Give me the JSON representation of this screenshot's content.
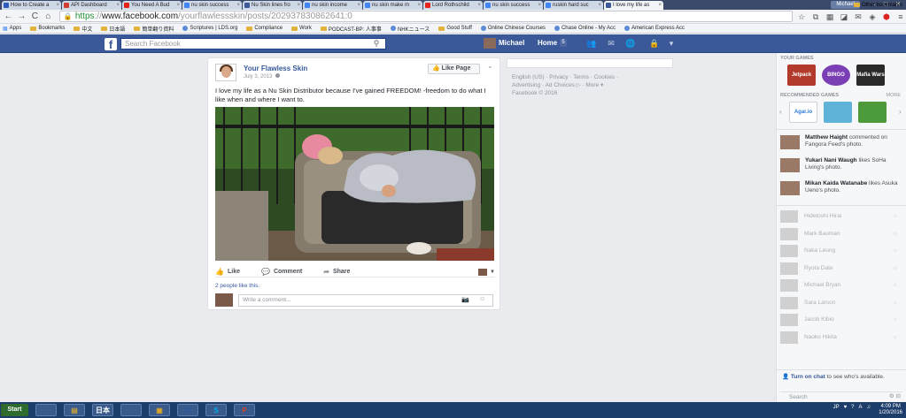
{
  "browser": {
    "tabs": [
      {
        "label": "How to Create a",
        "fav": "#2a5bbd"
      },
      {
        "label": "API Dashboard",
        "fav": "#d23f31"
      },
      {
        "label": "You Need A Bud",
        "fav": "#e62117"
      },
      {
        "label": "nu skin success",
        "fav": "#4285f4"
      },
      {
        "label": "Nu Skin lines fro",
        "fav": "#3b5998"
      },
      {
        "label": "nu skin income",
        "fav": "#4285f4"
      },
      {
        "label": "nu skin make m",
        "fav": "#4285f4"
      },
      {
        "label": "Lord Rothschild",
        "fav": "#e62117"
      },
      {
        "label": "nu skin success",
        "fav": "#4285f4"
      },
      {
        "label": "ruskin hard suc",
        "fav": "#4285f4"
      },
      {
        "label": "I love my life as",
        "fav": "#3b5998"
      }
    ],
    "window_user": "Michael",
    "window_controls": [
      "–",
      "□",
      "✕"
    ],
    "url_scheme": "https",
    "url_host": "www.facebook.com",
    "url_path": "/yourflawlessskin/posts/202937830862641:0",
    "nav": {
      "back": "←",
      "forward": "→",
      "reload": "C",
      "home": "⌂"
    }
  },
  "bookmarks": [
    {
      "label": "Apps",
      "kind": "apps"
    },
    {
      "label": "Bookmarks",
      "kind": "folder"
    },
    {
      "label": "中文",
      "kind": "folder"
    },
    {
      "label": "日本語",
      "kind": "folder"
    },
    {
      "label": "簡単翻り資料",
      "kind": "folder"
    },
    {
      "label": "Scriptures | LDS.org",
      "kind": "globe"
    },
    {
      "label": "Compliance",
      "kind": "folder"
    },
    {
      "label": "Work",
      "kind": "folder"
    },
    {
      "label": "PODCAST-BP: 人事事",
      "kind": "folder"
    },
    {
      "label": "NHKニュース",
      "kind": "globe"
    },
    {
      "label": "Good Stuff",
      "kind": "folder"
    },
    {
      "label": "Online Chinese Courses",
      "kind": "globe"
    },
    {
      "label": "Chase Online - My Acc",
      "kind": "globe"
    },
    {
      "label": "American Express Acc",
      "kind": "globe"
    }
  ],
  "bookmarks_other": "Other bookmarks",
  "fb": {
    "search_placeholder": "Search Facebook",
    "user_name": "Michael",
    "home_label": "Home",
    "home_count": "5"
  },
  "post": {
    "author": "Your Flawless Skin",
    "date": "July 3, 2013",
    "like_page_label": "Like Page",
    "text": "I love my life as a Nu Skin Distributor because I've gained FREEDOM! -freedom to do what I like when and where I want to.",
    "actions": {
      "like": "Like",
      "comment": "Comment",
      "share": "Share"
    },
    "likes_text": "2 people like this.",
    "comment_placeholder": "Write a comment..."
  },
  "info_links": {
    "line1": "English (US) · Privacy · Terms · Cookies ·",
    "line2": "Advertising · Ad Choices ▷ · More ▾",
    "line3": "Facebook © 2016"
  },
  "sidebar": {
    "your_games_heading": "YOUR GAMES",
    "recommended_heading": "RECOMMENDED GAMES",
    "recommended_more": "MORE",
    "your_games": [
      {
        "label": "Jetpack",
        "color": "#b23a2a"
      },
      {
        "label": "BINGO",
        "color": "#7a3fb5"
      },
      {
        "label": "Mafia Wars",
        "color": "#2a2a2a"
      }
    ],
    "recommended_games": [
      {
        "label": "Agar.io",
        "color": "#ffffff"
      },
      {
        "label": "",
        "color": "#5fb3d9"
      },
      {
        "label": "",
        "color": "#4c9a3a"
      }
    ],
    "ticker": [
      {
        "name": "Matthew Haight",
        "action": "commented on Fangora Feed's photo."
      },
      {
        "name": "Yukari Nani Waugh",
        "action": "likes SoHa Living's photo."
      },
      {
        "name": "Mikan Kaida Watanabe",
        "action": "likes Asuka Ueno's photo."
      }
    ],
    "chat": [
      {
        "name": "Hidetoshi Hirai"
      },
      {
        "name": "Mark Bauman"
      },
      {
        "name": "Naka Leung"
      },
      {
        "name": "Ryota Date"
      },
      {
        "name": "Michael Bryan"
      },
      {
        "name": "Sara Larson"
      },
      {
        "name": "Jacob Kibio"
      },
      {
        "name": "Naoko Hikita"
      }
    ],
    "chat_turn_link": "Turn on chat",
    "chat_turn_rest": "to see who's available.",
    "chat_search": "Search"
  },
  "taskbar": {
    "start": "Start",
    "apps": [
      {
        "glyph": "◉",
        "color": "#3a5a8c"
      },
      {
        "glyph": "▤",
        "color": "#c9a23a"
      },
      {
        "glyph": "日本",
        "color": "#ffffff"
      },
      {
        "glyph": "⚙",
        "color": "#3a5a8c"
      },
      {
        "glyph": "▣",
        "color": "#d9a52a"
      },
      {
        "glyph": "W",
        "color": "#2b579a"
      },
      {
        "glyph": "S",
        "color": "#00aff0"
      },
      {
        "glyph": "P",
        "color": "#d24726"
      }
    ],
    "tray": [
      "JP",
      "♥",
      "?",
      "A",
      "♫"
    ],
    "time": "4:09 PM",
    "date": "1/20/2016"
  }
}
